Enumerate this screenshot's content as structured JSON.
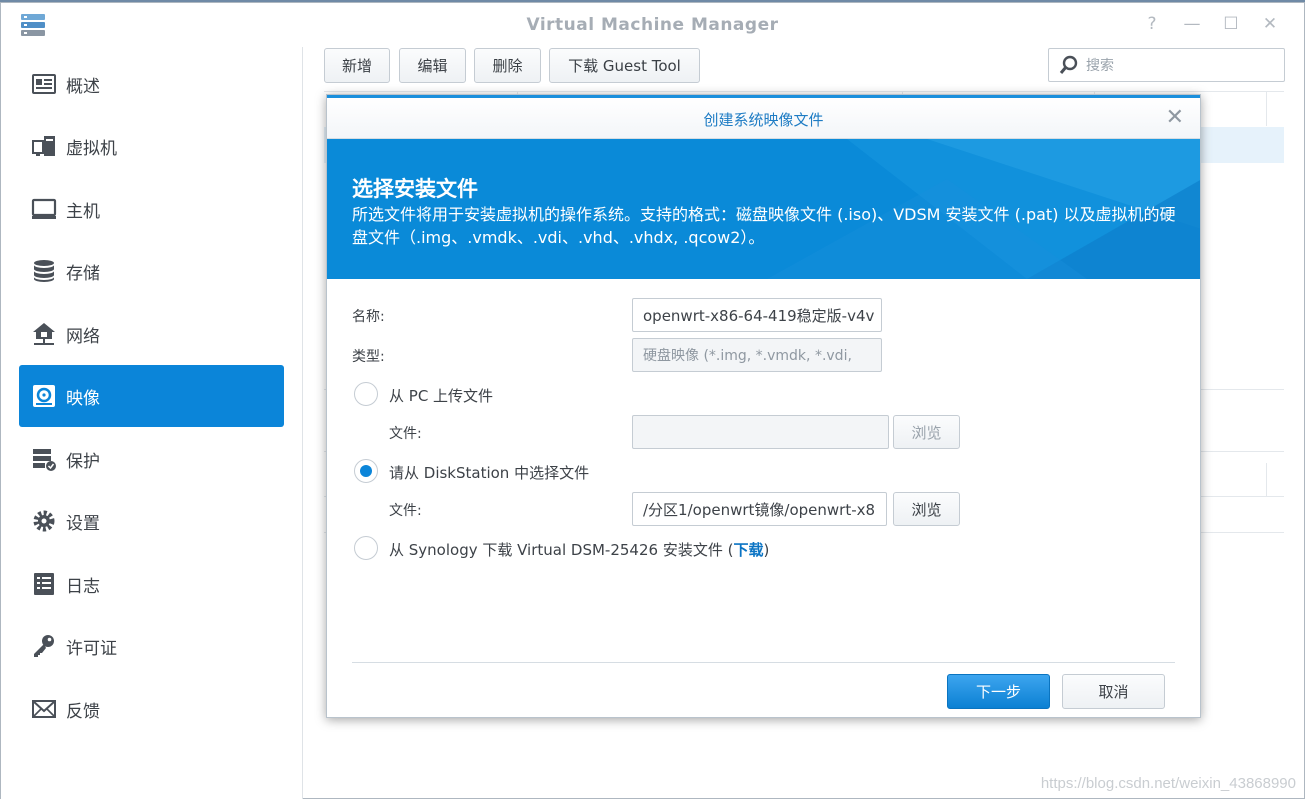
{
  "window": {
    "title": "Virtual Machine Manager",
    "help_glyph": "?",
    "minimize_glyph": "—",
    "maximize_glyph": "☐",
    "close_glyph": "✕"
  },
  "sidebar": {
    "active_color": "#0b85d9",
    "items": [
      {
        "label": "概述",
        "icon": "overview-icon"
      },
      {
        "label": "虚拟机",
        "icon": "virtual-machine-icon"
      },
      {
        "label": "主机",
        "icon": "host-monitor-icon"
      },
      {
        "label": "存储",
        "icon": "storage-icon"
      },
      {
        "label": "网络",
        "icon": "network-icon"
      },
      {
        "label": "映像",
        "icon": "image-disc-icon",
        "active": true
      },
      {
        "label": "保护",
        "icon": "protection-icon"
      },
      {
        "label": "设置",
        "icon": "gear-icon"
      },
      {
        "label": "日志",
        "icon": "log-icon"
      },
      {
        "label": "许可证",
        "icon": "key-icon"
      },
      {
        "label": "反馈",
        "icon": "mail-icon"
      }
    ]
  },
  "toolbar": {
    "add_label": "新增",
    "edit_label": "编辑",
    "delete_label": "删除",
    "download_label": "下载 Guest Tool",
    "search_placeholder": "搜索"
  },
  "dialog": {
    "title": "创建系统映像文件",
    "close_glyph": "✕",
    "banner_title": "选择安装文件",
    "banner_desc": "所选文件将用于安装虚拟机的操作系统。支持的格式：磁盘映像文件 (.iso)、VDSM 安装文件 (.pat) 以及虚拟机的硬盘文件（.img、.vmdk、.vdi、.vhd、.vhdx, .qcow2）。",
    "name_label": "名称:",
    "name_value": "openwrt-x86-64-419稳定版-v4v",
    "type_label": "类型:",
    "type_value": "硬盘映像 (*.img, *.vmdk, *.vdi,",
    "option_pc_upload": "从 PC 上传文件",
    "file_label_1": "文件:",
    "file_value_1": "",
    "browse_label_1": "浏览",
    "option_diskstation": "请从 DiskStation 中选择文件",
    "file_label_2": "文件:",
    "file_value_2": "/分区1/openwrt镜像/openwrt-x8",
    "browse_label_2": "浏览",
    "option_synology_prefix": "从 Synology 下载 Virtual DSM-25426 安装文件 (",
    "option_synology_link": "下载",
    "option_synology_suffix": ")",
    "next_label": "下一步",
    "cancel_label": "取消",
    "selected_option": "diskstation"
  },
  "watermark": "https://blog.csdn.net/weixin_43868990"
}
